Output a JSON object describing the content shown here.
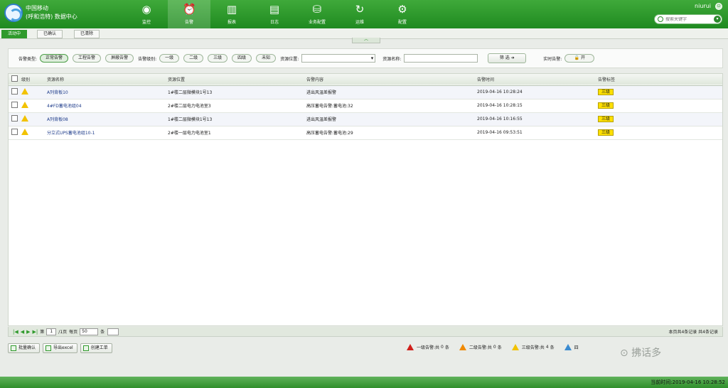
{
  "header": {
    "brand_line1": "中国移动",
    "brand_line2": "(呼和浩特) 数据中心",
    "username": "niurui",
    "search_placeholder": "搜索关键字",
    "nav": [
      {
        "label": "监控",
        "icon": "dashboard-icon"
      },
      {
        "label": "告警",
        "icon": "alarm-clock-icon"
      },
      {
        "label": "报表",
        "icon": "bar-chart-icon"
      },
      {
        "label": "日志",
        "icon": "log-document-icon"
      },
      {
        "label": "业务配置",
        "icon": "database-icon"
      },
      {
        "label": "运维",
        "icon": "cycle-icon"
      },
      {
        "label": "配置",
        "icon": "gear-icon"
      }
    ]
  },
  "subtabs": [
    "活动中",
    "已确认",
    "已清除"
  ],
  "filter": {
    "type_label": "告警类型:",
    "types": [
      "正常告警",
      "工程告警",
      "屏蔽告警"
    ],
    "level_label": "告警级别:",
    "levels": [
      "一级",
      "二级",
      "三级",
      "四级",
      "未知"
    ],
    "position_label": "资源位置:",
    "position_value": "",
    "name_label": "资源名称:",
    "name_value": "",
    "filter_button": "筛 选",
    "realtime_label": "实时告警:",
    "realtime_toggle": "开"
  },
  "table": {
    "columns": [
      "级别",
      "资源名称",
      "资源位置",
      "告警内容",
      "告警时间",
      "告警标签"
    ],
    "rows": [
      {
        "name": "A列背板10",
        "location": "1#楼二层微模块1号13",
        "content": "进出风温差报警",
        "time": "2019-04-16 10:28:24",
        "tag": "三级"
      },
      {
        "name": "4#FD蓄电池组04",
        "location": "2#楼二层电力电池室3",
        "content": "高压蓄电告警:蓄电池:32",
        "time": "2019-04-16 10:28:15",
        "tag": "三级"
      },
      {
        "name": "A列背板08",
        "location": "1#楼二层微模块1号13",
        "content": "进出风温差报警",
        "time": "2019-04-16 10:16:55",
        "tag": "三级"
      },
      {
        "name": "分立式UPS蓄电池组10-1",
        "location": "2#楼一层电力电池室1",
        "content": "高压蓄电告警:蓄电池:29",
        "time": "2019-04-16 09:53:51",
        "tag": "三级"
      }
    ]
  },
  "pager": {
    "page_prefix": "第",
    "page_value": "1",
    "page_total": "/1页",
    "per_page_label": "每页",
    "per_page_value": "50",
    "per_page_suffix": "条",
    "summary": "本页共4条记录 共4条记录"
  },
  "actions": [
    "批量确认",
    "导出excel",
    "创建工单"
  ],
  "legend": [
    {
      "label": "一级告警:共",
      "count": "0",
      "unit": "条",
      "color": "#d0201b"
    },
    {
      "label": "二级告警:共",
      "count": "0",
      "unit": "条",
      "color": "#f08a00"
    },
    {
      "label": "三级告警:共",
      "count": "4",
      "unit": "条",
      "color": "#f2c200"
    },
    {
      "label": "四",
      "count": "",
      "unit": "",
      "color": "#3a8bd0"
    }
  ],
  "watermark": "⊙ 拂话多",
  "footer_time": "当前时间:2019-04-16 10:28:52"
}
